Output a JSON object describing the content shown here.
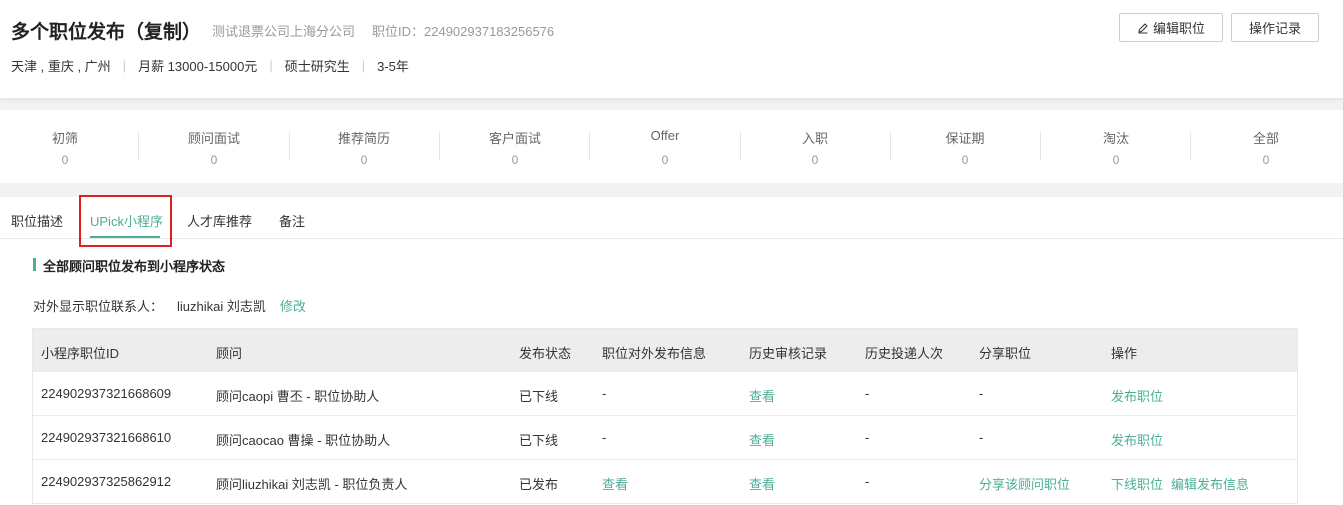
{
  "header": {
    "title": "多个职位发布（复制）",
    "company": "测试退票公司上海分公司",
    "job_id": "职位ID：224902937183256576",
    "cities": "天津 , 重庆 , 广州",
    "salary": "月薪 13000-15000元",
    "education": "硕士研究生",
    "experience": "3-5年",
    "edit_button": "编辑职位",
    "log_button": "操作记录"
  },
  "stats": [
    {
      "label": "初筛",
      "value": "0"
    },
    {
      "label": "顾问面试",
      "value": "0"
    },
    {
      "label": "推荐简历",
      "value": "0"
    },
    {
      "label": "客户面试",
      "value": "0"
    },
    {
      "label": "Offer",
      "value": "0"
    },
    {
      "label": "入职",
      "value": "0"
    },
    {
      "label": "保证期",
      "value": "0"
    },
    {
      "label": "淘汰",
      "value": "0"
    },
    {
      "label": "全部",
      "value": "0"
    }
  ],
  "tabs": [
    {
      "label": "职位描述"
    },
    {
      "label": "UPick小程序"
    },
    {
      "label": "人才库推荐"
    },
    {
      "label": "备注"
    }
  ],
  "section": {
    "title": "全部顾问职位发布到小程序状态",
    "contact_label": "对外显示职位联系人：",
    "contact_name": "liuzhikai 刘志凯",
    "modify": "修改"
  },
  "table": {
    "headers": [
      "小程序职位ID",
      "顾问",
      "发布状态",
      "职位对外发布信息",
      "历史审核记录",
      "历史投递人次",
      "分享职位",
      "操作"
    ],
    "rows": [
      {
        "id": "224902937321668609",
        "consultant": "顾问caopi 曹丕 - 职位协助人",
        "status": "已下线",
        "info": "-",
        "history": "查看",
        "deliveries": "-",
        "share": "-",
        "action1": "发布职位",
        "action2": ""
      },
      {
        "id": "224902937321668610",
        "consultant": "顾问caocao 曹操 - 职位协助人",
        "status": "已下线",
        "info": "-",
        "history": "查看",
        "deliveries": "-",
        "share": "-",
        "action1": "发布职位",
        "action2": ""
      },
      {
        "id": "224902937325862912",
        "consultant": "顾问liuzhikai 刘志凯 - 职位负责人",
        "status": "已发布",
        "info": "查看",
        "history": "查看",
        "deliveries": "-",
        "share": "分享该顾问职位",
        "action1": "下线职位",
        "action2": "编辑发布信息"
      }
    ]
  },
  "colors": {
    "accent": "#4cae97",
    "highlight": "#e02020"
  }
}
